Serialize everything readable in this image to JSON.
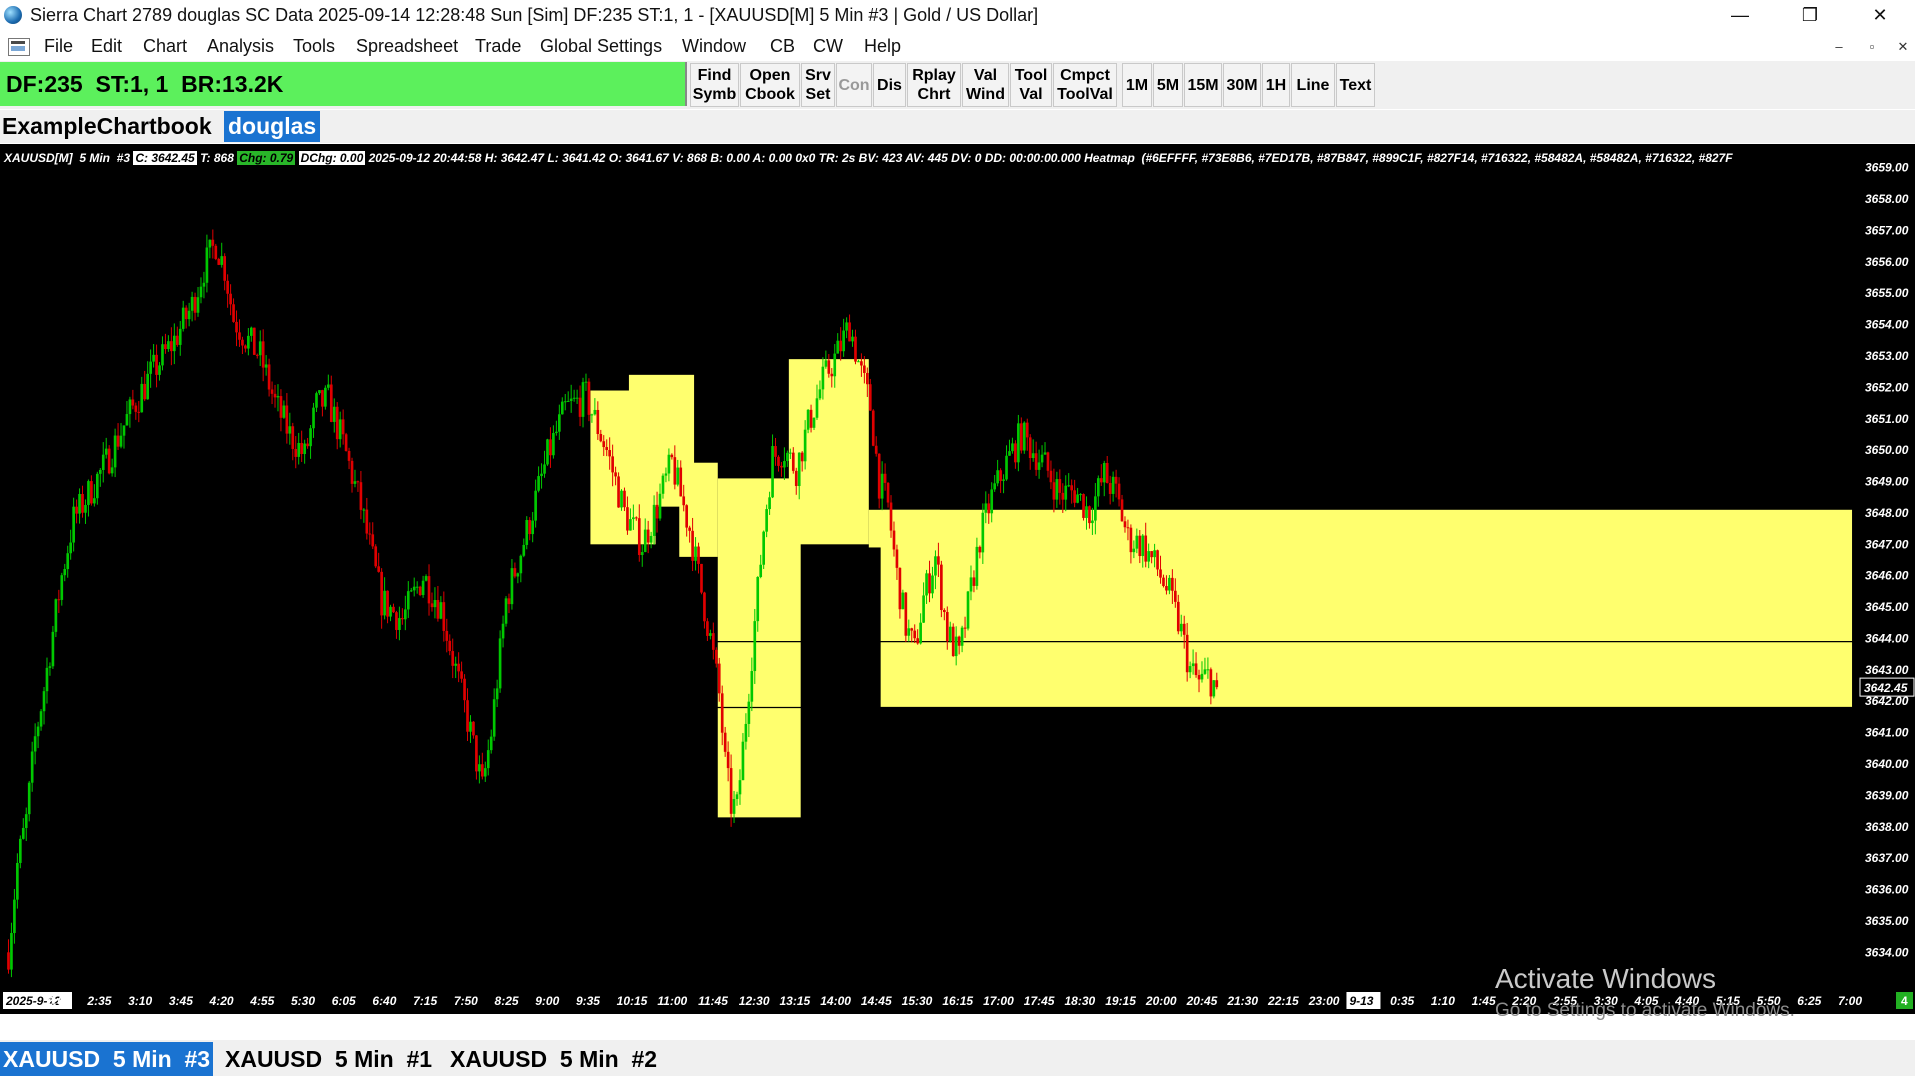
{
  "window": {
    "title": "Sierra Chart 2789 douglas SC Data 2025-09-14  12:28:48 Sun [Sim] DF:235  ST:1, 1 - [XAUUSD[M]  5 Min  #3 | Gold / US Dollar]",
    "minimize": "—",
    "maximize": "❐",
    "close": "✕"
  },
  "menu": {
    "items": [
      "File",
      "Edit",
      "Chart",
      "Analysis",
      "Tools",
      "Spreadsheet",
      "Trade",
      "Global Settings",
      "Window",
      "CB",
      "CW",
      "Help"
    ],
    "mdi_min": "–",
    "mdi_restore": "▫",
    "mdi_close": "✕"
  },
  "control_bar": {
    "status": "DF:235  ST:1, 1  BR:13.2K",
    "status_color": "#5cf05c",
    "buttons": [
      {
        "label": "Find\nSymb",
        "enabled": true
      },
      {
        "label": "Open\nCbook",
        "enabled": true
      },
      {
        "label": "Srv\nSet",
        "enabled": true
      },
      {
        "label": "Con",
        "enabled": false
      },
      {
        "label": "Dis",
        "enabled": true
      },
      {
        "label": "Rplay\nChrt",
        "enabled": true
      },
      {
        "label": "Val\nWind",
        "enabled": true
      },
      {
        "label": "Tool\nVal",
        "enabled": true
      },
      {
        "label": "Cmpct\nToolVal",
        "enabled": true
      },
      {
        "label": "1M",
        "enabled": true
      },
      {
        "label": "5M",
        "enabled": true
      },
      {
        "label": "15M",
        "enabled": true
      },
      {
        "label": "30M",
        "enabled": true
      },
      {
        "label": "1H",
        "enabled": true
      },
      {
        "label": "Line",
        "enabled": true
      },
      {
        "label": "Text",
        "enabled": true
      }
    ]
  },
  "chartbook": {
    "name": "ExampleChartbook",
    "user": "douglas"
  },
  "info_line": {
    "symbol": "XAUUSD[M]  5 Min  #3",
    "close": "C: 3642.45",
    "trades": "T: 868",
    "change": "Chg: 0.79",
    "daily_change": "DChg: 0.00",
    "rest": "2025-09-12 20:44:58 H: 3642.47 L: 3641.42 O: 3641.67 V: 868 B: 0.00 A: 0.00 0x0 TR: 2s BV: 423 AV: 445 DV: 0 DD: 00:00:00.000 Heatmap  (#6EFFFF, #73E8B6, #7ED17B, #87B847, #899C1F, #827F14, #716322, #58482A, #58482A, #716322, #827F"
  },
  "chart_data": {
    "type": "candlestick",
    "symbol": "XAUUSD[M]",
    "timeframe": "5 Min",
    "last_price": 3642.45,
    "price_axis_labels": [
      "3659.00",
      "3658.00",
      "3657.00",
      "3656.00",
      "3655.00",
      "3654.00",
      "3653.00",
      "3652.00",
      "3651.00",
      "3650.00",
      "3649.00",
      "3648.00",
      "3647.00",
      "3646.00",
      "3645.00",
      "3644.00",
      "3643.00",
      "3642.00",
      "3641.00",
      "3640.00",
      "3639.00",
      "3638.00",
      "3637.00",
      "3636.00",
      "3635.00",
      "3634.00"
    ],
    "ylim": [
      3633.15,
      3659.5
    ],
    "time_axis_labels": [
      "2025-9-12",
      "2:00",
      "2:35",
      "3:10",
      "3:45",
      "4:20",
      "4:55",
      "5:30",
      "6:05",
      "6:40",
      "7:15",
      "7:50",
      "8:25",
      "9:00",
      "9:35",
      "10:15",
      "11:00",
      "11:45",
      "12:30",
      "13:15",
      "14:00",
      "14:45",
      "15:30",
      "16:15",
      "17:00",
      "17:45",
      "18:30",
      "19:15",
      "20:00",
      "20:45",
      "21:30",
      "22:15",
      "23:00",
      "9-13",
      "0:35",
      "1:10",
      "1:45",
      "2:20",
      "2:55",
      "3:30",
      "4:05",
      "4:40",
      "5:15",
      "5:50",
      "6:25",
      "7:00"
    ],
    "highlighted_time_labels": [
      "2025-9-12",
      "9-13"
    ],
    "path_points": [
      [
        0,
        3634.0
      ],
      [
        3,
        3636.8
      ],
      [
        6,
        3638.2
      ],
      [
        9,
        3640.8
      ],
      [
        12,
        3642.4
      ],
      [
        15,
        3644.2
      ],
      [
        18,
        3646.0
      ],
      [
        22,
        3647.8
      ],
      [
        27,
        3648.6
      ],
      [
        33,
        3649.6
      ],
      [
        40,
        3651.0
      ],
      [
        48,
        3652.4
      ],
      [
        56,
        3653.5
      ],
      [
        62,
        3654.6
      ],
      [
        66,
        3655.8
      ],
      [
        70,
        3656.6
      ],
      [
        73,
        3655.8
      ],
      [
        76,
        3654.2
      ],
      [
        80,
        3653.6
      ],
      [
        85,
        3653.0
      ],
      [
        90,
        3651.5
      ],
      [
        95,
        3650.5
      ],
      [
        100,
        3649.8
      ],
      [
        104,
        3651.4
      ],
      [
        108,
        3651.6
      ],
      [
        113,
        3650.2
      ],
      [
        119,
        3648.2
      ],
      [
        126,
        3645.2
      ],
      [
        133,
        3644.6
      ],
      [
        140,
        3646.0
      ],
      [
        146,
        3645.0
      ],
      [
        151,
        3643.0
      ],
      [
        156,
        3641.0
      ],
      [
        160,
        3639.2
      ],
      [
        163,
        3641.0
      ],
      [
        168,
        3645.2
      ],
      [
        175,
        3647.4
      ],
      [
        182,
        3649.8
      ],
      [
        188,
        3651.3
      ],
      [
        195,
        3651.7
      ],
      [
        202,
        3650.0
      ],
      [
        208,
        3648.0
      ],
      [
        214,
        3647.0
      ],
      [
        219,
        3648.2
      ],
      [
        224,
        3649.6
      ],
      [
        230,
        3647.5
      ],
      [
        234,
        3645.5
      ],
      [
        237,
        3644.0
      ],
      [
        240,
        3642.2
      ],
      [
        242,
        3640.0
      ],
      [
        244,
        3638.7
      ],
      [
        246,
        3638.6
      ],
      [
        248,
        3640.5
      ],
      [
        251,
        3643.5
      ],
      [
        255,
        3647.5
      ],
      [
        258,
        3649.8
      ],
      [
        262,
        3650.0
      ],
      [
        266,
        3649.4
      ],
      [
        270,
        3650.8
      ],
      [
        275,
        3652.2
      ],
      [
        280,
        3653.1
      ],
      [
        284,
        3654.0
      ],
      [
        288,
        3652.4
      ],
      [
        291,
        3651.4
      ],
      [
        294,
        3649.0
      ],
      [
        297,
        3648.2
      ],
      [
        300,
        3646.0
      ],
      [
        303,
        3644.4
      ],
      [
        306,
        3643.6
      ],
      [
        309,
        3645.3
      ],
      [
        313,
        3646.6
      ],
      [
        317,
        3644.2
      ],
      [
        321,
        3643.4
      ],
      [
        324,
        3645.0
      ],
      [
        328,
        3647.2
      ],
      [
        332,
        3648.5
      ],
      [
        337,
        3649.6
      ],
      [
        342,
        3650.5
      ],
      [
        346,
        3650.0
      ],
      [
        350,
        3649.5
      ],
      [
        355,
        3648.6
      ],
      [
        360,
        3648.7
      ],
      [
        365,
        3648.0
      ],
      [
        370,
        3649.2
      ],
      [
        374,
        3648.6
      ],
      [
        378,
        3647.2
      ],
      [
        383,
        3647.0
      ],
      [
        388,
        3646.2
      ],
      [
        392,
        3645.4
      ],
      [
        396,
        3644.2
      ],
      [
        399,
        3643.0
      ],
      [
        402,
        3642.6
      ],
      [
        405,
        3642.8
      ],
      [
        408,
        3642.45
      ]
    ],
    "heatmap_blocks": [
      {
        "from": 3647.0,
        "to": 3651.9,
        "start": 197,
        "end": 219,
        "color": "#ffff6e"
      },
      {
        "from": 3648.2,
        "to": 3652.4,
        "start": 210,
        "end": 232,
        "color": "#ffff6e"
      },
      {
        "from": 3646.6,
        "to": 3649.6,
        "start": 227,
        "end": 240,
        "color": "#ffff6e"
      },
      {
        "from": 3638.3,
        "to": 3649.1,
        "start": 240,
        "end": 268,
        "color": "#ffff6e"
      },
      {
        "from": 3647.0,
        "to": 3652.9,
        "start": 264,
        "end": 291,
        "color": "#ffff6e"
      },
      {
        "from": 3646.9,
        "to": 3648.1,
        "start": 291,
        "end": 315,
        "color": "#ffff6e"
      },
      {
        "from": 3641.8,
        "to": 3648.1,
        "start": 295,
        "end": 623,
        "color": "#ffff6e"
      }
    ],
    "horizontal_lines": [
      3643.9,
      3641.8
    ],
    "bottom_right_indicator": "4",
    "grid": false
  },
  "taskbar_tabs": [
    {
      "label": "XAUUSD  5 Min  #3",
      "active": true
    },
    {
      "label": "XAUUSD  5 Min  #1",
      "active": false
    },
    {
      "label": "XAUUSD  5 Min  #2",
      "active": false
    }
  ],
  "watermark": {
    "line1": "Activate Windows",
    "line2": "Go to Settings to activate Windows."
  },
  "colors": {
    "up_bar": "#00c800",
    "down_bar": "#e00000",
    "heatmap": "#ffff6e",
    "chart_bg": "#000000",
    "accent_blue": "#1a73d1"
  }
}
